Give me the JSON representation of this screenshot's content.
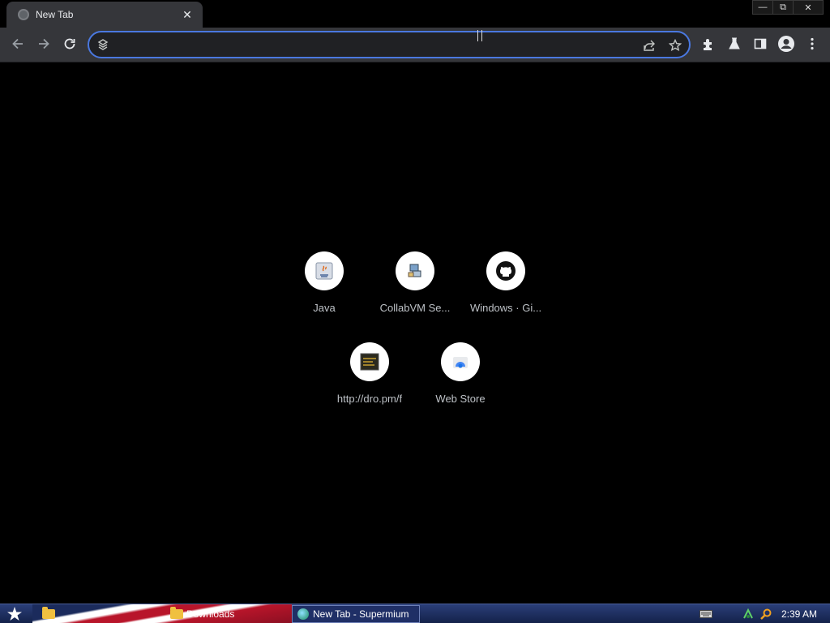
{
  "tab": {
    "title": "New Tab",
    "close_label": "✕"
  },
  "window": {
    "minimize": "—",
    "restore": "⧉",
    "close": "✕"
  },
  "omnibox": {
    "value": "",
    "placeholder": ""
  },
  "shortcuts": [
    {
      "label": "Java",
      "icon": "java-icon"
    },
    {
      "label": "CollabVM Se...",
      "icon": "collabvm-icon"
    },
    {
      "label": "Windows · Gi...",
      "icon": "github-icon"
    },
    {
      "label": "http://dro.pm/f",
      "icon": "dro-pm-icon"
    },
    {
      "label": "Web Store",
      "icon": "web-store-icon"
    }
  ],
  "taskbar": {
    "items": [
      {
        "label": "Downloads",
        "icon": "folder-icon"
      },
      {
        "label": "New Tab - Supermium",
        "icon": "browser-icon"
      }
    ],
    "clock": "2:39 AM"
  },
  "colors": {
    "omnibox_focus": "#4a78e0",
    "toolbar": "#35363a",
    "background": "#000000",
    "taskbar": "#1f2f66"
  }
}
